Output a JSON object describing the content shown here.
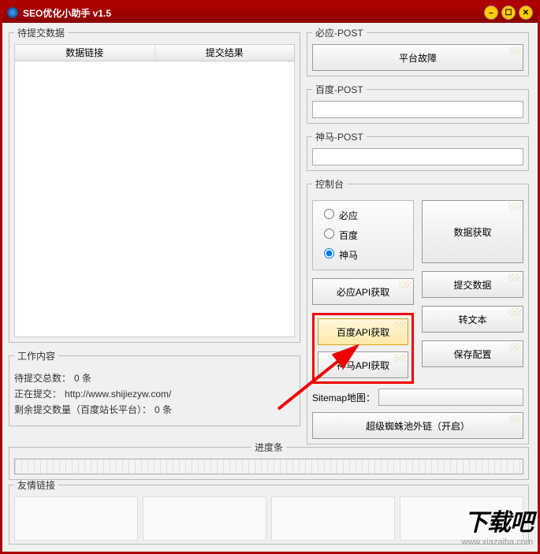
{
  "title": "SEO优化小助手 v1.5",
  "left": {
    "pending_legend": "待提交数据",
    "col_link": "数据链接",
    "col_result": "提交结果",
    "work_legend": "工作内容",
    "pending_total_label": "待提交总数：",
    "pending_total_value": "0 条",
    "submitting_label": "正在提交：",
    "submitting_value": "http://www.shijiezyw.com/",
    "remain_label": "剩余提交数量（百度站长平台）：",
    "remain_value": "0 条"
  },
  "right": {
    "biying_legend": "必应-POST",
    "biying_btn": "平台故障",
    "baidu_legend": "百度-POST",
    "baidu_value": "",
    "shenma_legend": "神马-POST",
    "shenma_value": "",
    "console_legend": "控制台",
    "radios": {
      "biying": "必应",
      "baidu": "百度",
      "shenma": "神马"
    },
    "btn_fetch_data": "数据获取",
    "btn_biying_api": "必应API获取",
    "btn_submit": "提交数据",
    "btn_baidu_api": "百度API获取",
    "btn_totext": "转文本",
    "btn_shenma_api": "神马API获取",
    "btn_save": "保存配置",
    "sitemap_label": "Sitemap地图：",
    "sitemap_value": "",
    "spider_btn": "超级蜘蛛池外链（开启）"
  },
  "progress_legend": "进度条",
  "friend_legend": "友情链接",
  "watermark": {
    "logo": "下载吧",
    "url": "www.xiazaiba.com"
  }
}
